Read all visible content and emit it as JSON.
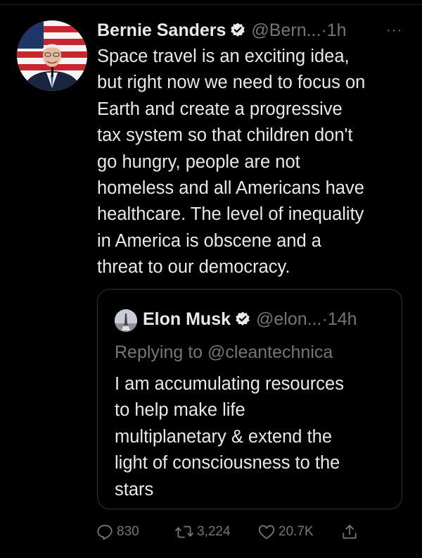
{
  "tweet": {
    "author": {
      "display_name": "Bernie Sanders",
      "handle": "@Bern...",
      "separator": "·",
      "time": "1h",
      "verified_icon": "verified-badge-icon",
      "more_icon": "···"
    },
    "text": "Space travel is an exciting idea,\nbut right now we need to focus on\nEarth and create a progressive\ntax system so that children don't\ngo hungry, people are not\nhomeless and all Americans have\nhealthcare. The level of inequality\nin America is obscene and a\nthreat to our democracy.",
    "quoted_tweet": {
      "display_name": "Elon Musk",
      "handle": "@elon...",
      "separator": "·",
      "time": "14h",
      "replying_to": "Replying to @cleantechnica",
      "text": "I am accumulating resources\nto help make life\nmultiplanetary & extend the\nlight of consciousness to the\nstars"
    },
    "actions": {
      "replies": "830",
      "retweets": "3,224",
      "likes": "20.7K"
    }
  },
  "colors": {
    "background": "#000000",
    "primary_text": "#e7e9ea",
    "secondary_text": "#71767b",
    "border": "#2f3336",
    "verified_badge": "#e7e9ea"
  }
}
